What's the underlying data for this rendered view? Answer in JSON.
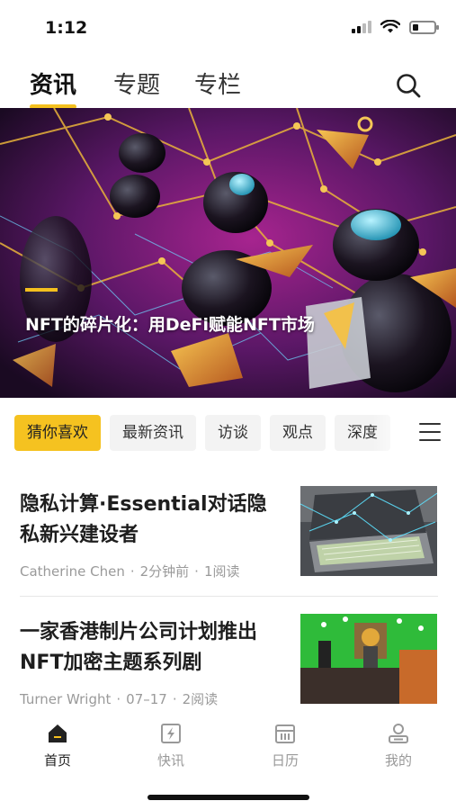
{
  "status_bar": {
    "time": "1:12"
  },
  "top_tabs": [
    {
      "label": "资讯",
      "active": true
    },
    {
      "label": "专题",
      "active": false
    },
    {
      "label": "专栏",
      "active": false
    }
  ],
  "hero": {
    "title": "NFT的碎片化：用DeFi赋能NFT市场"
  },
  "categories": [
    {
      "label": "猜你喜欢",
      "active": true
    },
    {
      "label": "最新资讯",
      "active": false
    },
    {
      "label": "访谈",
      "active": false
    },
    {
      "label": "观点",
      "active": false
    },
    {
      "label": "深度",
      "active": false
    }
  ],
  "articles": [
    {
      "title": "隐私计算·Essential对话隐私新兴建设者",
      "author": "Catherine Chen",
      "time": "2分钟前",
      "reads": "1阅读"
    },
    {
      "title": "一家香港制片公司计划推出NFT加密主题系列剧",
      "author": "Turner Wright",
      "time": "07–17",
      "reads": "2阅读"
    }
  ],
  "bottom_nav": [
    {
      "label": "首页",
      "icon": "home-icon",
      "active": true
    },
    {
      "label": "快讯",
      "icon": "flash-news-icon",
      "active": false
    },
    {
      "label": "日历",
      "icon": "calendar-icon",
      "active": false
    },
    {
      "label": "我的",
      "icon": "profile-icon",
      "active": false
    }
  ],
  "colors": {
    "accent": "#f5c220",
    "text": "#1e1e1e",
    "muted": "#9a9a9a"
  }
}
